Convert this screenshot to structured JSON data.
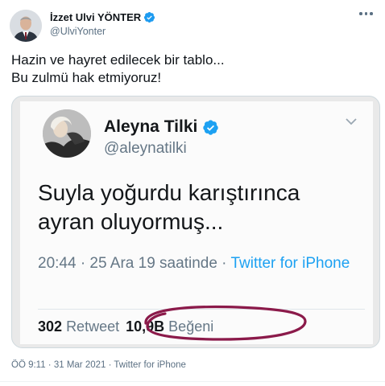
{
  "author": {
    "display_name": "İzzet Ulvi YÖNTER",
    "handle": "@UlviYonter",
    "avatar_icon": "profile-avatar",
    "verified_icon": "verified-badge-icon",
    "more_icon": "more-options-icon"
  },
  "tweet": {
    "lines": [
      "Hazin ve hayret edilecek bir tablo...",
      "Bu zulmü hak etmiyoruz!"
    ]
  },
  "embedded_screenshot": {
    "display_name": "Aleyna Tilki",
    "handle": "@aleynatilki",
    "text_lines": [
      "Suyla yoğurdu karıştırınca",
      "ayran oluyormuş..."
    ],
    "meta_prefix": "20:44 · 25 Ara 19 saatinde · ",
    "meta_link": "Twitter for iPhone",
    "retweet_count": "302",
    "retweet_label": "Retweet",
    "like_count": "10,9B",
    "like_label": "Beğeni",
    "annotation_color": "#8b1a4a"
  },
  "footer": {
    "timestamp": "ÖÖ 9:11 · 31 Mar 2021 · Twitter for iPhone"
  },
  "colors": {
    "verified": "#1d9bf0",
    "secondary_text": "#5b7083",
    "link": "#1da1f2"
  }
}
